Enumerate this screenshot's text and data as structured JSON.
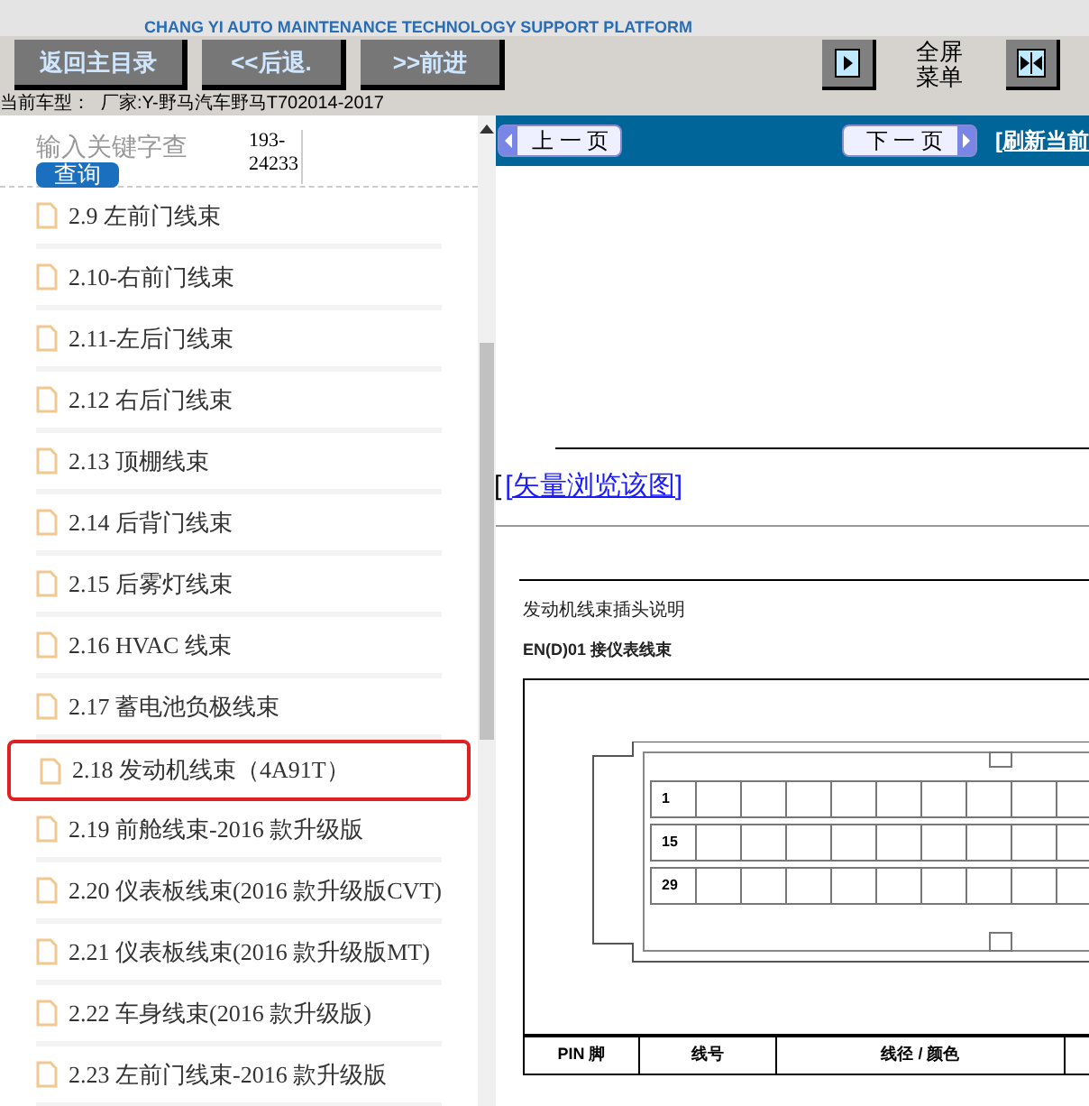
{
  "banner": {
    "subtitle": "CHANG YI AUTO MAINTENANCE TECHNOLOGY SUPPORT PLATFORM"
  },
  "toolbar": {
    "buttons": [
      "返回主目录",
      "<<后退.",
      ">>前进"
    ],
    "fullscreen_label": "全屏菜单"
  },
  "current_model": {
    "label": "当前车型：",
    "value": "厂家:Y-野马汽车野马T702014-2017"
  },
  "search": {
    "placeholder": "输入关键字查",
    "button": "查询",
    "code": "193-24233"
  },
  "sidebar": {
    "items": [
      {
        "label": "2.9 左前门线束",
        "selected": false
      },
      {
        "label": "2.10-右前门线束",
        "selected": false
      },
      {
        "label": "2.11-左后门线束",
        "selected": false
      },
      {
        "label": "2.12 右后门线束",
        "selected": false
      },
      {
        "label": "2.13 顶棚线束",
        "selected": false
      },
      {
        "label": "2.14 后背门线束",
        "selected": false
      },
      {
        "label": "2.15 后雾灯线束",
        "selected": false
      },
      {
        "label": "2.16 HVAC 线束",
        "selected": false
      },
      {
        "label": "2.17 蓄电池负极线束",
        "selected": false
      },
      {
        "label": "2.18 发动机线束（4A91T）",
        "selected": true
      },
      {
        "label": "2.19 前舱线束-2016 款升级版",
        "selected": false
      },
      {
        "label": "2.20 仪表板线束(2016 款升级版CVT)",
        "selected": false
      },
      {
        "label": "2.21 仪表板线束(2016 款升级版MT)",
        "selected": false
      },
      {
        "label": "2.22 车身线束(2016 款升级版)",
        "selected": false
      },
      {
        "label": "2.23 左前门线束-2016 款升级版",
        "selected": false
      }
    ]
  },
  "viewer": {
    "prev": "上 一 页",
    "next": "下 一 页",
    "refresh": "[刷新当前",
    "bracket": "[",
    "vector_link": "[矢量浏览该图]",
    "doc_title": "发动机线束插头说明",
    "connector_title": "EN(D)01 接仪表线束",
    "pins": [
      "1",
      "15",
      "29"
    ],
    "table_columns": [
      "PIN 脚",
      "线号",
      "线径 / 颜色"
    ]
  }
}
